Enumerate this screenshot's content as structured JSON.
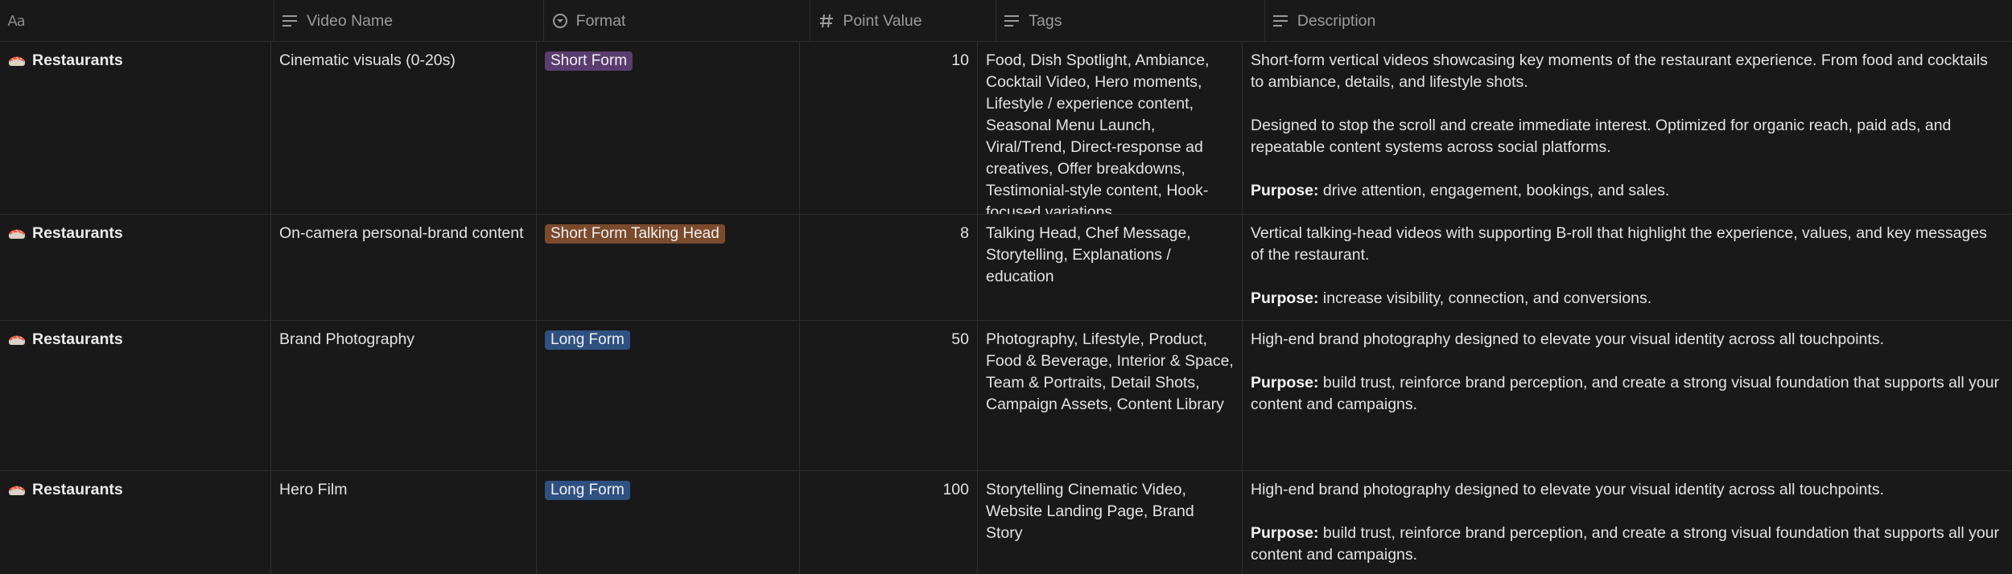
{
  "columns": [
    {
      "label": "",
      "icon": "title-aa-icon"
    },
    {
      "label": "Video Name",
      "icon": "text-lines-icon"
    },
    {
      "label": "Format",
      "icon": "select-circle-icon"
    },
    {
      "label": "Point Value",
      "icon": "number-hash-icon"
    },
    {
      "label": "Tags",
      "icon": "text-lines-icon"
    },
    {
      "label": "Description",
      "icon": "text-lines-icon"
    }
  ],
  "header_aa": "Aa",
  "badge_colors": {
    "purple": "#5a3d6e",
    "brown": "#7a4a2c",
    "blue": "#2f5182"
  },
  "rows": [
    {
      "name": "Restaurants",
      "emoji": "sushi-icon",
      "video_name": "Cinematic visuals (0-20s)",
      "format": "Short Form",
      "format_color": "purple",
      "points": "10",
      "tags": "Food, Dish Spotlight, Ambiance, Cocktail Video, Hero moments, Lifestyle / experience content, Seasonal Menu Launch, Viral/Trend, Direct-response ad creatives, Offer breakdowns,  Testimonial-style content, Hook-focused variations",
      "desc1": "Short-form vertical videos showcasing key moments of the restaurant experience. From food and cocktails to ambiance, details, and lifestyle shots.",
      "desc2": "Designed to stop the scroll and create immediate interest. Optimized for organic reach, paid ads, and repeatable content systems across social platforms.",
      "purpose_label": "Purpose:",
      "purpose": " drive attention, engagement, bookings, and sales."
    },
    {
      "name": "Restaurants",
      "emoji": "sushi-icon",
      "video_name": "On-camera personal-brand content",
      "format": "Short Form Talking Head",
      "format_color": "brown",
      "points": "8",
      "tags": "Talking Head, Chef Message, Storytelling, Explanations / education",
      "desc1": "Vertical talking-head videos with supporting B-roll that highlight the experience, values, and key messages of the restaurant.",
      "desc2": "",
      "purpose_label": "Purpose:",
      "purpose": " increase visibility, connection, and conversions."
    },
    {
      "name": "Restaurants",
      "emoji": "sushi-icon",
      "video_name": "Brand Photography",
      "format": "Long Form",
      "format_color": "blue",
      "points": "50",
      "tags": "Photography, Lifestyle, Product, Food & Beverage, Interior & Space, Team & Portraits, Detail Shots, Campaign Assets, Content Library",
      "desc1": "High-end brand photography designed to elevate your visual identity across all touchpoints.",
      "desc2": "",
      "purpose_label": "Purpose:",
      "purpose": " build trust, reinforce brand perception, and create a strong visual foundation that supports all your content and campaigns."
    },
    {
      "name": "Restaurants",
      "emoji": "sushi-icon",
      "video_name": "Hero Film",
      "format": "Long Form",
      "format_color": "blue",
      "points": "100",
      "tags": "Storytelling Cinematic Video, Website Landing Page, Brand Story",
      "desc1": "High-end brand photography designed to elevate your visual identity across all touchpoints.",
      "desc2": "",
      "purpose_label": "Purpose:",
      "purpose": " build trust, reinforce brand perception, and create a strong visual foundation that supports all your content and campaigns."
    }
  ]
}
